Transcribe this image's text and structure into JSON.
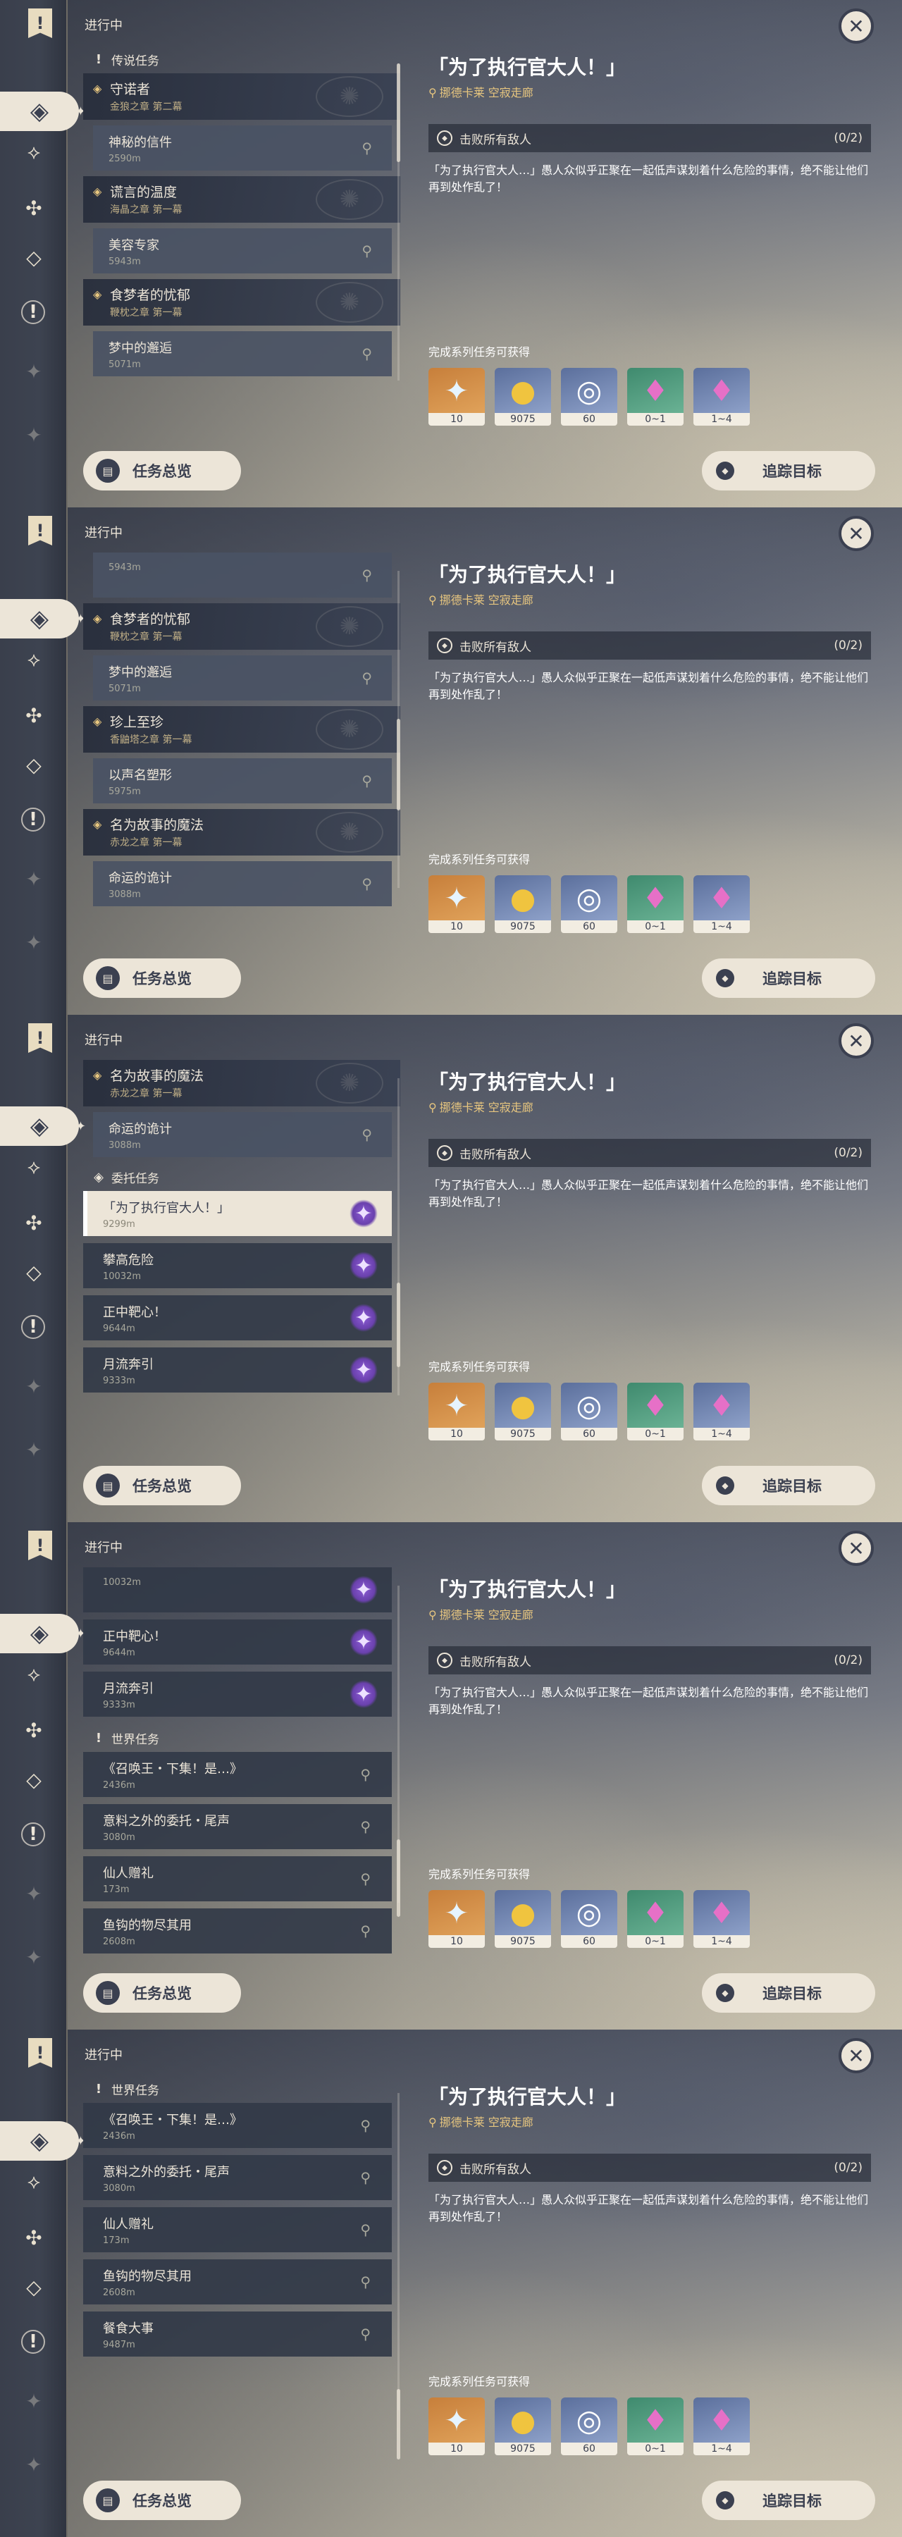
{
  "common": {
    "progress_label": "进行中",
    "detail": {
      "title": "「为了执行官大人！」",
      "location": "挪德卡莱 空寂走廊",
      "objective": "击败所有敌人",
      "objective_count": "(0/2)",
      "description": "「为了执行官大人…」愚人众似乎正聚在一起低声谋划着什么危险的事情，绝不能让他们再到处作乱了！",
      "rewards_label": "完成系列任务可获得",
      "rewards": [
        {
          "icon": "primogem-icon",
          "glyph": "✦",
          "count": "10"
        },
        {
          "icon": "mora-icon",
          "glyph": "●",
          "count": "9075"
        },
        {
          "icon": "adventure-exp-icon",
          "glyph": "◎",
          "count": "60"
        },
        {
          "icon": "ore-icon",
          "glyph": "♦",
          "count": "0~1"
        },
        {
          "icon": "crystal-icon",
          "glyph": "♦",
          "count": "1~4"
        }
      ]
    },
    "buttons": {
      "overview": "任务总览",
      "track": "追踪目标"
    }
  },
  "panels": [
    {
      "list": [
        {
          "kind": "section",
          "icon": "!",
          "label": "传说任务"
        },
        {
          "kind": "parent",
          "title": "守诺者",
          "chapter": "金狼之章 第二幕"
        },
        {
          "kind": "child",
          "title": "神秘的信件",
          "dist": "2590m"
        },
        {
          "kind": "parent",
          "title": "谎言的温度",
          "chapter": "海晶之章 第一幕"
        },
        {
          "kind": "child",
          "title": "美容专家",
          "dist": "5943m"
        },
        {
          "kind": "parent",
          "title": "食梦者的忧郁",
          "chapter": "鞭枕之章 第一幕"
        },
        {
          "kind": "child",
          "title": "梦中的邂逅",
          "dist": "5071m"
        }
      ]
    },
    {
      "list": [
        {
          "kind": "child",
          "title": "",
          "dist": "5943m"
        },
        {
          "kind": "parent",
          "title": "食梦者的忧郁",
          "chapter": "鞭枕之章 第一幕"
        },
        {
          "kind": "child",
          "title": "梦中的邂逅",
          "dist": "5071m"
        },
        {
          "kind": "parent",
          "title": "珍上至珍",
          "chapter": "香鼬塔之章 第一幕"
        },
        {
          "kind": "child",
          "title": "以声名塑形",
          "dist": "5975m"
        },
        {
          "kind": "parent",
          "title": "名为故事的魔法",
          "chapter": "赤龙之章 第一幕"
        },
        {
          "kind": "child",
          "title": "命运的诡计",
          "dist": "3088m"
        }
      ]
    },
    {
      "list": [
        {
          "kind": "parent",
          "title": "名为故事的魔法",
          "chapter": "赤龙之章 第一幕"
        },
        {
          "kind": "child",
          "title": "命运的诡计",
          "dist": "3088m"
        },
        {
          "kind": "section",
          "icon": "◈",
          "label": "委托任务"
        },
        {
          "kind": "row",
          "title": "「为了执行官大人！」",
          "dist": "9299m",
          "mark": "star",
          "selected": true
        },
        {
          "kind": "row",
          "title": "攀高危险",
          "dist": "10032m",
          "mark": "star"
        },
        {
          "kind": "row",
          "title": "正中靶心！",
          "dist": "9644m",
          "mark": "star"
        },
        {
          "kind": "row",
          "title": "月流奔引",
          "dist": "9333m",
          "mark": "star"
        }
      ]
    },
    {
      "list": [
        {
          "kind": "row",
          "title": "",
          "dist": "10032m",
          "mark": "star"
        },
        {
          "kind": "row",
          "title": "正中靶心！",
          "dist": "9644m",
          "mark": "star"
        },
        {
          "kind": "row",
          "title": "月流奔引",
          "dist": "9333m",
          "mark": "star"
        },
        {
          "kind": "section",
          "icon": "!",
          "label": "世界任务"
        },
        {
          "kind": "row",
          "title": "《召唤王・下集！是…》",
          "dist": "2436m",
          "mark": "pin"
        },
        {
          "kind": "row",
          "title": "意料之外的委托・尾声",
          "dist": "3080m",
          "mark": "pin"
        },
        {
          "kind": "row",
          "title": "仙人赠礼",
          "dist": "173m",
          "mark": "pin"
        },
        {
          "kind": "row",
          "title": "鱼钩的物尽其用",
          "dist": "2608m",
          "mark": "pin"
        }
      ]
    },
    {
      "list": [
        {
          "kind": "section",
          "icon": "!",
          "label": "世界任务"
        },
        {
          "kind": "row",
          "title": "《召唤王・下集！是…》",
          "dist": "2436m",
          "mark": "pin"
        },
        {
          "kind": "row",
          "title": "意料之外的委托・尾声",
          "dist": "3080m",
          "mark": "pin"
        },
        {
          "kind": "row",
          "title": "仙人赠礼",
          "dist": "173m",
          "mark": "pin"
        },
        {
          "kind": "row",
          "title": "鱼钩的物尽其用",
          "dist": "2608m",
          "mark": "pin"
        },
        {
          "kind": "row",
          "title": "餐食大事",
          "dist": "9487m",
          "mark": "pin"
        }
      ]
    }
  ]
}
